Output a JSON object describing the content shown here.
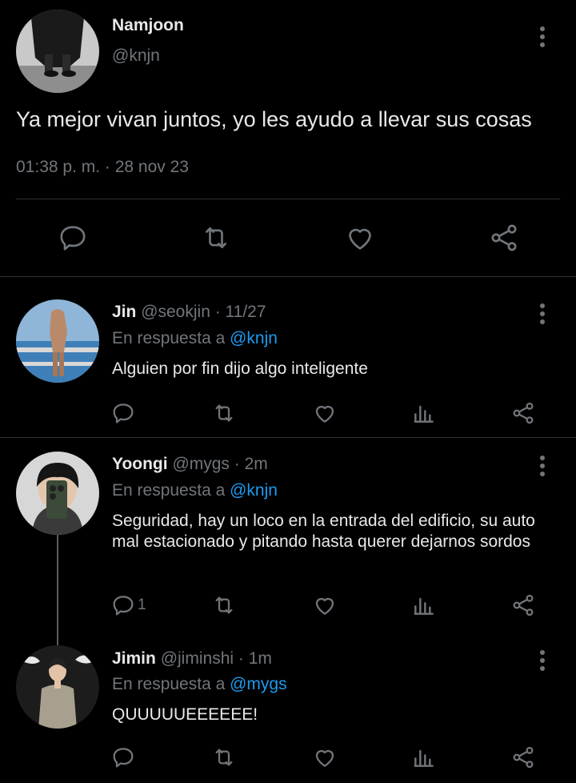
{
  "main_tweet": {
    "name": "Namjoon",
    "handle": "@knjn",
    "text": "Ya mejor vivan juntos, yo les ayudo a llevar sus cosas",
    "meta": "01:38 p. m. · 28 nov 23",
    "icons": [
      "reply-icon",
      "retweet-icon",
      "like-icon",
      "share-icon"
    ]
  },
  "replies": [
    {
      "name": "Jin",
      "handle": "@seokjin",
      "time": "· 11/27",
      "in_reply_prefix": "En respuesta a",
      "in_reply_to": "@knjn",
      "text": "Alguien por fin dijo algo inteligente",
      "reply_count": ""
    },
    {
      "name": "Yoongi",
      "handle": "@mygs",
      "time": "· 2m",
      "in_reply_prefix": "En respuesta a",
      "in_reply_to": "@knjn",
      "text": "Seguridad, hay un loco en la entrada del edificio, su auto mal estacionado y pitando hasta querer dejarnos sordos",
      "reply_count": "1"
    },
    {
      "name": "Jimin",
      "handle": "@jiminshi",
      "time": "· 1m",
      "in_reply_prefix": "En respuesta a",
      "in_reply_to": "@mygs",
      "text": "QUUUUUEEEEEE!",
      "reply_count": ""
    }
  ],
  "colors": {
    "background": "#000000",
    "text": "#e7e9ea",
    "secondary": "#71767b",
    "link": "#1d9bf0",
    "divider": "#2f3336"
  }
}
